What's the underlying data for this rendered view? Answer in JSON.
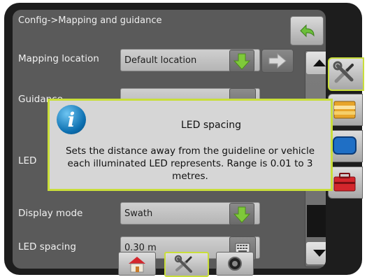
{
  "title": "Config->Mapping and guidance",
  "rows": [
    {
      "label": "Mapping location",
      "value": "Default location"
    },
    {
      "label": "Guidance",
      "value": ""
    },
    {
      "label": "LED",
      "value": ""
    },
    {
      "label": "Display mode",
      "value": "Swath"
    },
    {
      "label": "LED spacing",
      "value": "0.30 m"
    }
  ],
  "popup": {
    "title": "LED spacing",
    "body": "Sets the distance away from the guideline or vehicle each illuminated LED represents. Range is 0.01 to 3 metres."
  },
  "colors": {
    "accent": "#c9de3a",
    "green_arrow": "#7fc93a",
    "info_blue": "#0c6fb0"
  },
  "icons": {
    "back": "back-arrow-icon",
    "download": "green-down-arrow-icon",
    "next": "right-arrow-icon",
    "keyboard": "keyboard-icon",
    "scroll_up": "triangle-up-icon",
    "scroll_down": "triangle-down-icon",
    "side_tabs": [
      "tools-icon",
      "folder-icon",
      "blue-panel-icon",
      "toolbox-icon"
    ],
    "bottom": [
      "home-icon",
      "tools-icon",
      "speaker-icon"
    ]
  }
}
